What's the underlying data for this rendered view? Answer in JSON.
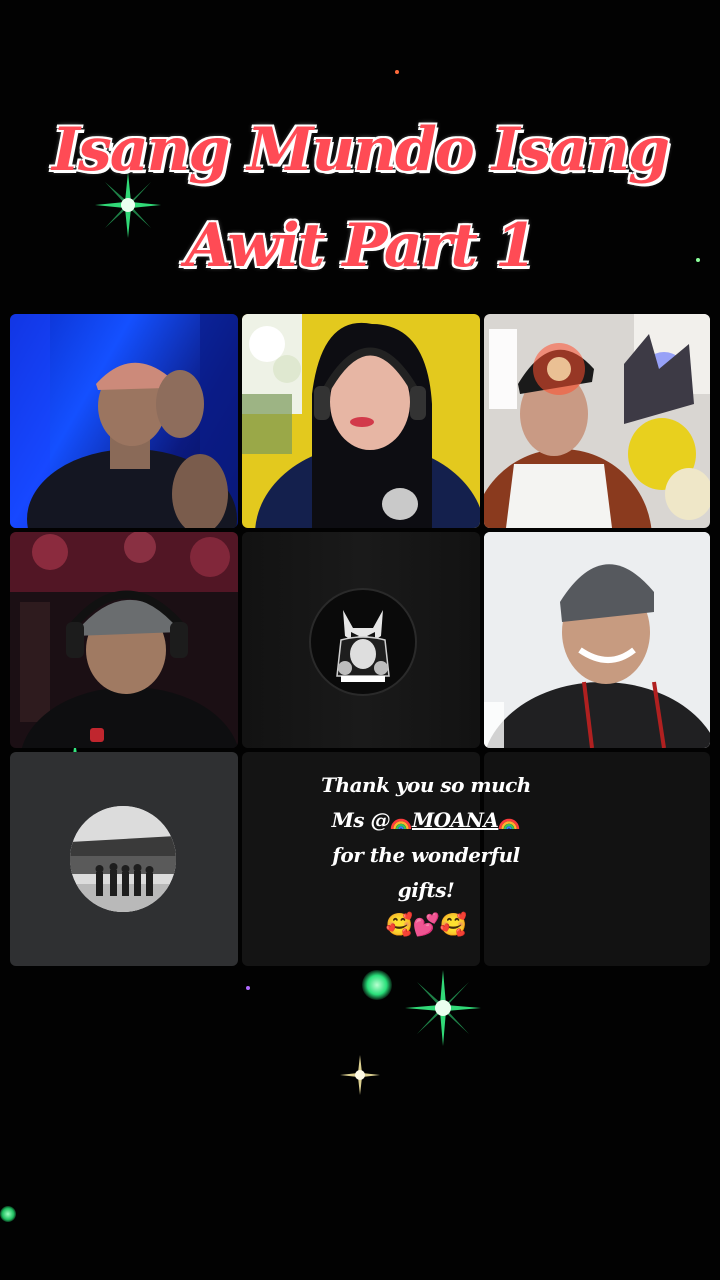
{
  "title": {
    "line1": "Isang Mundo Isang",
    "line2": "Awit Part 1"
  },
  "participants": [
    {
      "id": "p1",
      "desc": "host-cap-blue-background"
    },
    {
      "id": "p2",
      "desc": "singer-headphones-yellow-wall"
    },
    {
      "id": "p3",
      "desc": "singer-white-tank-plush-toys"
    },
    {
      "id": "p4",
      "desc": "singer-grey-cap-headphones"
    },
    {
      "id": "p5",
      "desc": "avatar-fox-mask-logo"
    },
    {
      "id": "p6",
      "desc": "singer-bandana"
    },
    {
      "id": "p7",
      "desc": "avatar-group-photo"
    },
    {
      "id": "p8",
      "desc": "message-tile"
    },
    {
      "id": "p9",
      "desc": "empty-tile"
    }
  ],
  "message": {
    "line1": "Thank you so much",
    "line2_prefix": "Ms @",
    "line2_name": "MOANA",
    "line3": "for the wonderful",
    "line4": "gifts!",
    "emoji": "🥰💕🥰"
  },
  "colors": {
    "title_red": "#ff4b55",
    "sparkle_green": "#3dff8a",
    "background": "#020202"
  }
}
